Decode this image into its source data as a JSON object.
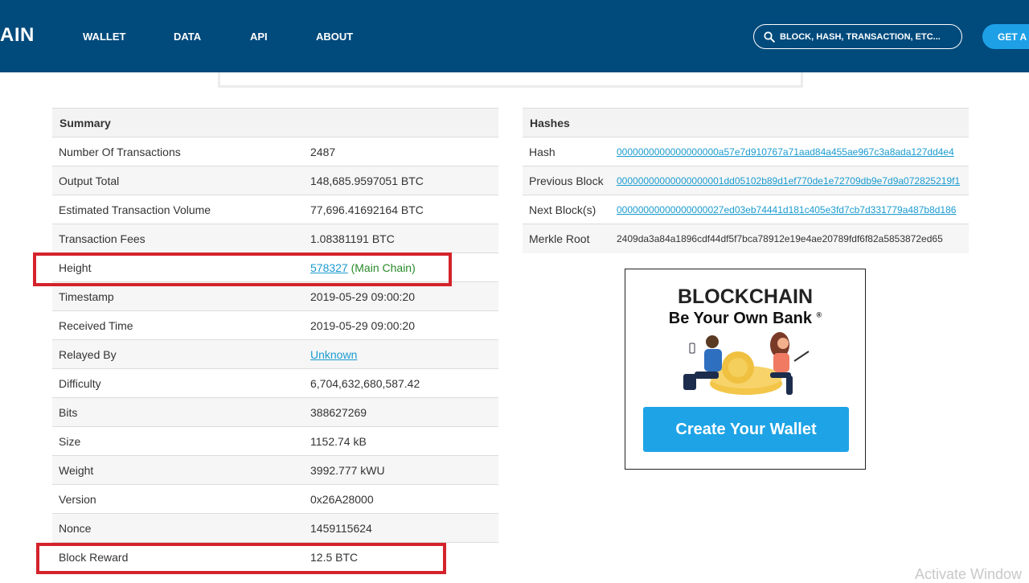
{
  "brand": {
    "logo_text": "AIN"
  },
  "nav": [
    "WALLET",
    "DATA",
    "API",
    "ABOUT"
  ],
  "search": {
    "placeholder": "BLOCK, HASH, TRANSACTION, ETC..."
  },
  "get_button": "GET A",
  "summary": {
    "header": "Summary",
    "rows": [
      {
        "key": "Number Of Transactions",
        "value": "2487"
      },
      {
        "key": "Output Total",
        "value": "148,685.9597051 BTC"
      },
      {
        "key": "Estimated Transaction Volume",
        "value": "77,696.41692164 BTC"
      },
      {
        "key": "Transaction Fees",
        "value": "1.08381191 BTC"
      },
      {
        "key": "Height",
        "value": "578327",
        "suffix": "(Main Chain)"
      },
      {
        "key": "Timestamp",
        "value": "2019-05-29 09:00:20"
      },
      {
        "key": "Received Time",
        "value": "2019-05-29 09:00:20"
      },
      {
        "key": "Relayed By",
        "value": "Unknown"
      },
      {
        "key": "Difficulty",
        "value": "6,704,632,680,587.42"
      },
      {
        "key": "Bits",
        "value": "388627269"
      },
      {
        "key": "Size",
        "value": "1152.74 kB"
      },
      {
        "key": "Weight",
        "value": "3992.777 kWU"
      },
      {
        "key": "Version",
        "value": "0x26A28000"
      },
      {
        "key": "Nonce",
        "value": "1459115624"
      },
      {
        "key": "Block Reward",
        "value": "12.5 BTC"
      }
    ]
  },
  "hashes": {
    "header": "Hashes",
    "rows": [
      {
        "key": "Hash",
        "value": "0000000000000000000a57e7d910767a71aad84a455ae967c3a8ada127dd4e4"
      },
      {
        "key": "Previous Block",
        "value": "00000000000000000001dd05102b89d1ef770de1e72709db9e7d9a072825219f1"
      },
      {
        "key": "Next Block(s)",
        "value": "00000000000000000027ed03eb74441d181c405e3fd7cb7d331779a487b8d186"
      },
      {
        "key": "Merkle Root",
        "value": "2409da3a84a1896cdf44df5f7bca78912e19e4ae20789fdf6f82a5853872ed65"
      }
    ]
  },
  "ad": {
    "title": "BLOCKCHAIN",
    "subtitle": "Be Your Own Bank",
    "registered": "®",
    "button": "Create Your Wallet"
  },
  "watermark": "Activate Window",
  "colors": {
    "header_bg": "#004a7c",
    "link": "#1a9bd0",
    "main_chain": "#2a8a2a",
    "highlight": "#d4232b",
    "cta": "#1ea3e6"
  }
}
